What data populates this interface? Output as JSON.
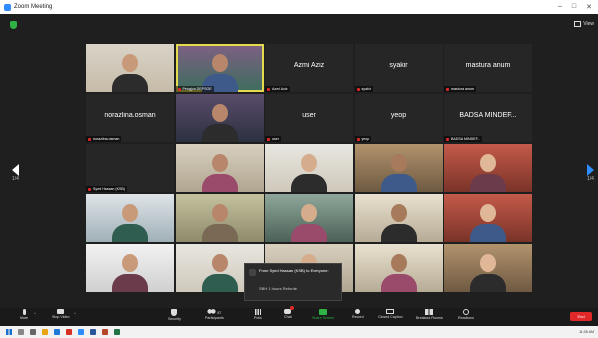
{
  "window": {
    "title": "Zoom Meeting"
  },
  "top_bar": {
    "view_label": "View"
  },
  "pager": {
    "left_label": "1/4",
    "right_label": "1/4"
  },
  "participants": [
    {
      "name": "",
      "scene": "a",
      "video": true
    },
    {
      "name": "Pengjun DEPSOE",
      "scene": "b",
      "video": true,
      "active": true
    },
    {
      "name": "Azmi Aziz",
      "display": "Azmi Aziz",
      "video": false
    },
    {
      "name": "syakir",
      "display": "syakir",
      "video": false
    },
    {
      "name": "mastura anum",
      "display": "mastura anum",
      "video": false
    },
    {
      "name": "norazlina.osman",
      "display": "norazlina.osman",
      "video": false
    },
    {
      "name": "",
      "scene": "c",
      "video": true
    },
    {
      "name": "user",
      "display": "user",
      "video": false
    },
    {
      "name": "yeop",
      "display": "yeop",
      "video": false
    },
    {
      "name": "BADSA MINDEF...",
      "display": "BADSA MINDEF...",
      "video": false
    },
    {
      "name": "Syed Hassan (KSB)",
      "video": false,
      "blank": true
    },
    {
      "name": "",
      "scene": "d",
      "video": true
    },
    {
      "name": "",
      "scene": "e",
      "video": true
    },
    {
      "name": "",
      "scene": "f",
      "video": true
    },
    {
      "name": "",
      "scene": "i",
      "video": true
    },
    {
      "name": "",
      "scene": "g",
      "video": true
    },
    {
      "name": "",
      "scene": "h",
      "video": true
    },
    {
      "name": "",
      "scene": "l",
      "video": true
    },
    {
      "name": "",
      "scene": "j",
      "video": true
    },
    {
      "name": "",
      "scene": "i",
      "video": true
    },
    {
      "name": "",
      "scene": "k",
      "video": true
    },
    {
      "name": "",
      "scene": "e",
      "video": true
    },
    {
      "name": "",
      "scene": "d",
      "video": true
    },
    {
      "name": "",
      "scene": "j",
      "video": true
    },
    {
      "name": "",
      "scene": "f",
      "video": true
    }
  ],
  "chat_popup": {
    "title": "From Syed Hassan (KSB) to Everyone:",
    "message": "SBH 1 hours Reforde"
  },
  "toolbar": {
    "mute": "Mute",
    "stop_video": "Stop Video",
    "security": "Security",
    "participants": "Participants",
    "participants_count": "87",
    "polls": "Polls",
    "chat": "Chat",
    "share_screen": "Share Screen",
    "record": "Record",
    "closed_caption": "Closed Caption",
    "breakout_rooms": "Breakout Rooms",
    "reactions": "Reactions",
    "end": "End"
  },
  "taskbar": {
    "time": "11:05 AM"
  },
  "colors": {
    "accent": "#2d8cff",
    "share": "#2fb344",
    "end": "#e02828",
    "active_border": "#e5d94c"
  }
}
